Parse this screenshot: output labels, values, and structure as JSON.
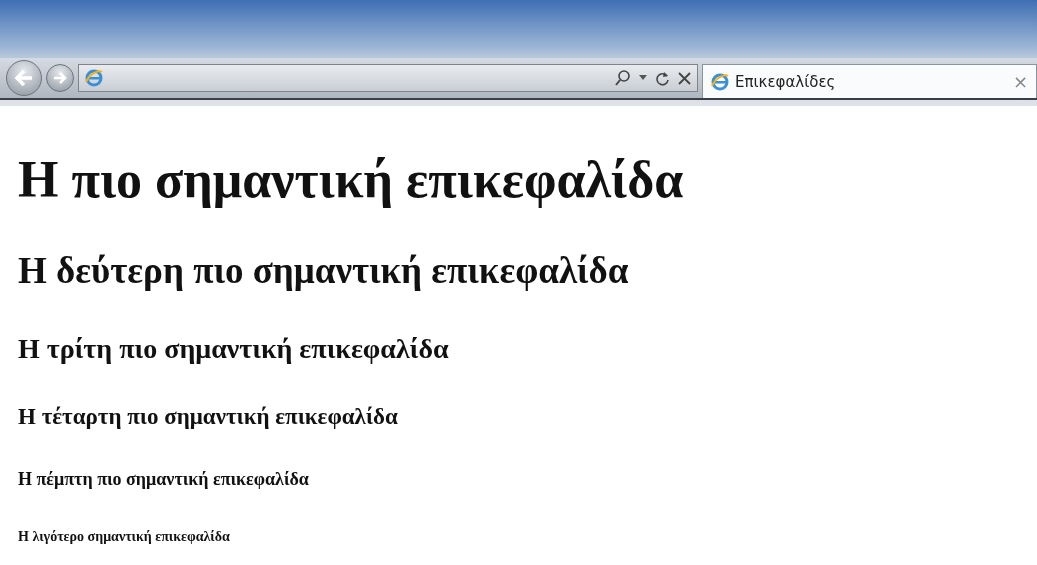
{
  "browser": {
    "tab": {
      "title": "Επικεφαλίδες",
      "selected": true,
      "close": "×"
    }
  },
  "headings": [
    {
      "kind": "h1",
      "text": "Η πιο σημαντική επικεφαλίδα"
    },
    {
      "kind": "h2",
      "text": "Η δεύτερη πιο σημαντική επικεφαλίδα"
    },
    {
      "kind": "h3",
      "text": "Η τρίτη πιο σημαντική επικεφαλίδα"
    },
    {
      "kind": "h4",
      "text": "Η τέταρτη πιο σημαντική επικεφαλίδα"
    },
    {
      "kind": "h5",
      "text": "Η πέμπτη πιο σημαντική επικεφαλίδα"
    },
    {
      "kind": "h6",
      "text": "Η λιγότερο σημαντική επικεφαλίδα"
    }
  ]
}
